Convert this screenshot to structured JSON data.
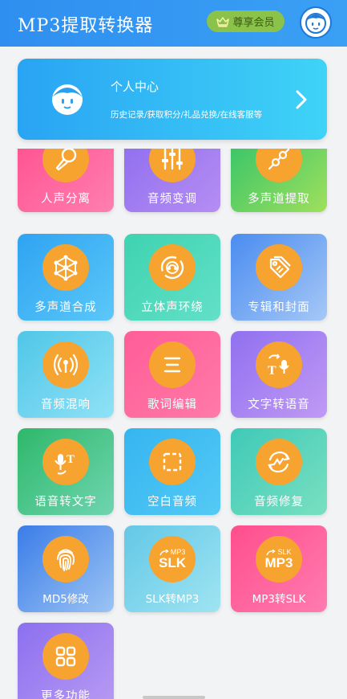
{
  "header": {
    "title": "MP3提取转换器",
    "vip_label": "尊享会员",
    "colors": {
      "bar": "#2f8ff0",
      "vip_bg": "#8bc34a"
    },
    "icons": {
      "vip": "crown-icon",
      "avatar": "avatar-face-icon"
    }
  },
  "profile": {
    "title": "个人中心",
    "subtitle": "历史记录/获取积分/礼品兑换/在线客服等",
    "icons": {
      "face": "face-icon",
      "arrow": "chevron-right-icon"
    }
  },
  "features": [
    {
      "label": "人声分离",
      "icon": "microphone-icon",
      "gradient": "g-pink"
    },
    {
      "label": "音频变调",
      "icon": "equalizer-sliders-icon",
      "gradient": "g-purple"
    },
    {
      "label": "多声道提取",
      "icon": "channel-slider-icon",
      "gradient": "g-green"
    },
    {
      "label": "多声道合成",
      "icon": "cube-nodes-icon",
      "gradient": "g-blue"
    },
    {
      "label": "立体声环绕",
      "icon": "surround-sound-icon",
      "gradient": "g-teal"
    },
    {
      "label": "专辑和封面",
      "icon": "tag-icon",
      "gradient": "g-blue2"
    },
    {
      "label": "音频混响",
      "icon": "broadcast-icon",
      "gradient": "g-cyan"
    },
    {
      "label": "歌词编辑",
      "icon": "lines-icon",
      "gradient": "g-pink2"
    },
    {
      "label": "文字转语音",
      "icon": "text-to-speech-icon",
      "gradient": "g-violet"
    },
    {
      "label": "语音转文字",
      "icon": "speech-to-text-icon",
      "gradient": "g-green2"
    },
    {
      "label": "空白音频",
      "icon": "dashed-square-icon",
      "gradient": "g-sky"
    },
    {
      "label": "音频修复",
      "icon": "repair-cycle-icon",
      "gradient": "g-teal2"
    },
    {
      "label": "MD5修改",
      "icon": "fingerprint-icon",
      "gradient": "g-blue3",
      "glyph": ""
    },
    {
      "label": "SLK转MP3",
      "icon": "slk-convert-icon",
      "gradient": "g-cyan2",
      "glyph_top": "MP3",
      "glyph_main": "SLK"
    },
    {
      "label": "MP3转SLK",
      "icon": "mp3-convert-icon",
      "gradient": "g-pink3",
      "glyph_top": "SLK",
      "glyph_main": "MP3"
    },
    {
      "label": "更多功能",
      "icon": "grid-more-icon",
      "gradient": "g-violet2"
    }
  ],
  "colors": {
    "icon_circle": "#f7a32f",
    "page_bg": "#f2f3f5"
  }
}
